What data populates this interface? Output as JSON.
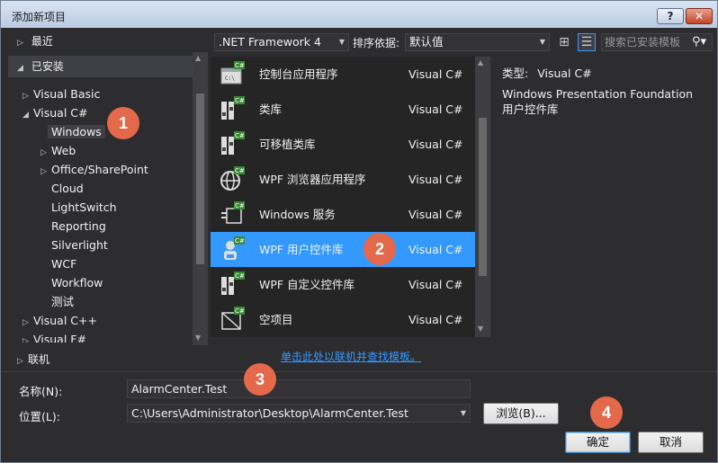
{
  "window": {
    "title": "添加新项目",
    "help_label": "?",
    "close_label": "✕"
  },
  "left_tree": {
    "recent": "最近",
    "installed": "已安装",
    "items": [
      {
        "label": "Visual Basic",
        "arrow": "▷"
      },
      {
        "label": "Visual C#",
        "arrow": "◢"
      },
      {
        "label": "Windows",
        "arrow": ""
      },
      {
        "label": "Web",
        "arrow": "▷"
      },
      {
        "label": "Office/SharePoint",
        "arrow": "▷"
      },
      {
        "label": "Cloud",
        "arrow": ""
      },
      {
        "label": "LightSwitch",
        "arrow": ""
      },
      {
        "label": "Reporting",
        "arrow": ""
      },
      {
        "label": "Silverlight",
        "arrow": ""
      },
      {
        "label": "WCF",
        "arrow": ""
      },
      {
        "label": "Workflow",
        "arrow": ""
      },
      {
        "label": "测试",
        "arrow": ""
      },
      {
        "label": "Visual C++",
        "arrow": "▷"
      },
      {
        "label": "Visual F#",
        "arrow": "▷"
      }
    ],
    "online": "联机"
  },
  "toolbar": {
    "framework": ".NET Framework 4",
    "sort_label": "排序依据:",
    "sort_value": "默认值",
    "search_placeholder": "搜索已安装模板"
  },
  "templates": [
    {
      "name": "控制台应用程序",
      "lang": "Visual C#",
      "icon": "console-app-icon"
    },
    {
      "name": "类库",
      "lang": "Visual C#",
      "icon": "class-library-icon"
    },
    {
      "name": "可移植类库",
      "lang": "Visual C#",
      "icon": "portable-library-icon"
    },
    {
      "name": "WPF 浏览器应用程序",
      "lang": "Visual C#",
      "icon": "wpf-browser-app-icon"
    },
    {
      "name": "Windows 服务",
      "lang": "Visual C#",
      "icon": "windows-service-icon"
    },
    {
      "name": "WPF 用户控件库",
      "lang": "Visual C#",
      "icon": "wpf-user-control-library-icon"
    },
    {
      "name": "WPF 自定义控件库",
      "lang": "Visual C#",
      "icon": "wpf-custom-control-library-icon"
    },
    {
      "name": "空项目",
      "lang": "Visual C#",
      "icon": "empty-project-icon"
    }
  ],
  "details": {
    "type_label": "类型:",
    "type_value": "Visual C#",
    "description": "Windows Presentation Foundation 用户控件库"
  },
  "online_link": "单击此处以联机并查找模板。",
  "form": {
    "name_label": "名称(N):",
    "name_value": "AlarmCenter.Test",
    "location_label": "位置(L):",
    "location_value": "C:\\Users\\Administrator\\Desktop\\AlarmCenter.Test",
    "browse_label": "浏览(B)...",
    "ok_label": "确定",
    "cancel_label": "取消"
  },
  "callouts": [
    "1",
    "2",
    "3",
    "4"
  ],
  "colors": {
    "selection": "#3399ff",
    "callout": "#e3694a",
    "background": "#2d2d30"
  }
}
